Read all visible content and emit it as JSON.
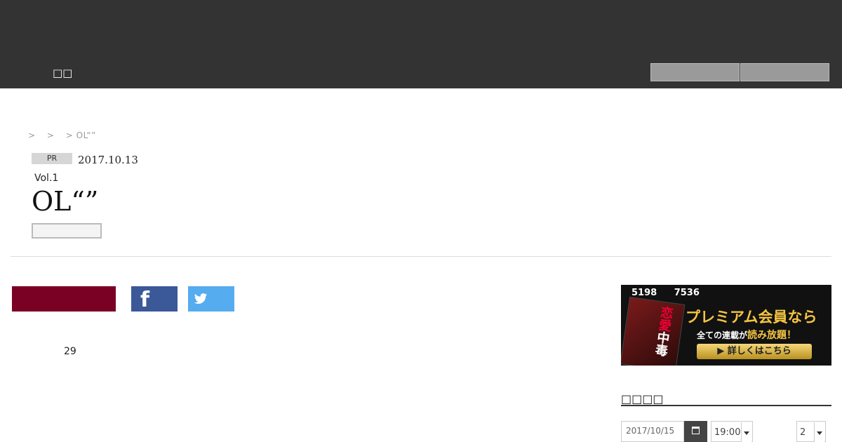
{
  "header": {
    "menu_label": "□□"
  },
  "breadcrumb": {
    "sep1": ">",
    "sep2": ">",
    "current": "> OL“”"
  },
  "article": {
    "badge": "PR",
    "date": "2017.10.13",
    "vol": "Vol.1",
    "title": "OL“”"
  },
  "share": {
    "facebook_icon": "f"
  },
  "count": "29",
  "banner": {
    "stat1": "5198",
    "stat2": "7536",
    "book_title_top": "恋愛",
    "book_title_bottom": "中毒",
    "promo_title": "プレミアム会員なら",
    "promo_sub_prefix": "全ての連載が",
    "promo_sub_highlight": "読み放題！",
    "promo_button": "▶ 詳しくはこちら"
  },
  "sidebar": {
    "section_title": "□□□□",
    "date_value": "2017/10/15",
    "time_value": "19:00",
    "count_value": "2"
  }
}
